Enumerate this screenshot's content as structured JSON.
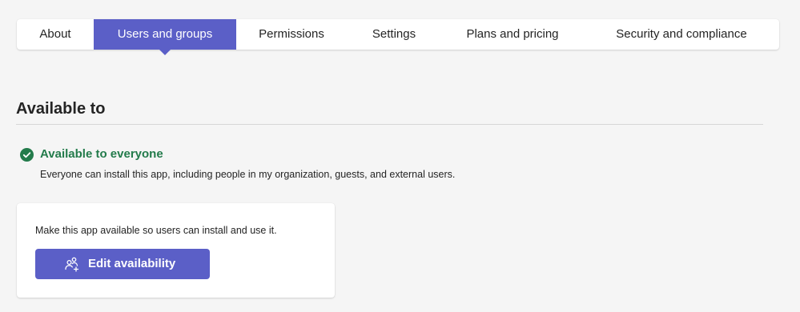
{
  "tabs": [
    {
      "label": "About",
      "active": false
    },
    {
      "label": "Users and groups",
      "active": true
    },
    {
      "label": "Permissions",
      "active": false
    },
    {
      "label": "Settings",
      "active": false
    },
    {
      "label": "Plans and pricing",
      "active": false
    },
    {
      "label": "Security and compliance",
      "active": false
    }
  ],
  "section": {
    "title": "Available to"
  },
  "availability": {
    "icon": "check-circle-icon",
    "label": "Available to everyone",
    "description": "Everyone can install this app, including people in my organization, guests, and external users."
  },
  "card": {
    "text": "Make this app available so users can install and use it.",
    "button_icon": "people-add-icon",
    "button_label": "Edit availability"
  },
  "colors": {
    "accent": "#5b5fc7",
    "success": "#237b4b",
    "background": "#f5f5f5"
  }
}
